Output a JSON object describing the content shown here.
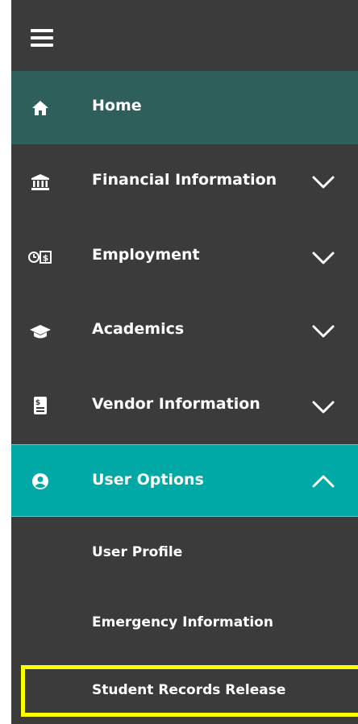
{
  "nav": {
    "items": [
      {
        "label": "Home",
        "icon": "home-icon",
        "active": true
      },
      {
        "label": "Financial Information",
        "icon": "bank-icon"
      },
      {
        "label": "Employment",
        "icon": "clock-dollar-icon"
      },
      {
        "label": "Academics",
        "icon": "graduation-cap-icon"
      },
      {
        "label": "Vendor Information",
        "icon": "receipt-icon"
      },
      {
        "label": "User Options",
        "icon": "user-circle-icon",
        "expanded": true
      }
    ],
    "sub_items": [
      {
        "label": "User Profile"
      },
      {
        "label": "Emergency Information"
      },
      {
        "label": "Student Records Release",
        "highlighted": true
      }
    ]
  },
  "colors": {
    "background": "#3b3b3b",
    "home_active": "#2e5f5a",
    "expanded": "#00a9a6",
    "highlight": "#ffff00"
  }
}
